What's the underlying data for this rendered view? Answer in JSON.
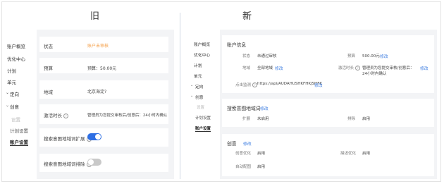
{
  "old": {
    "title": "旧",
    "nav": [
      {
        "label": "账户概览"
      },
      {
        "label": "优化中心"
      },
      {
        "label": "计划"
      },
      {
        "label": "单元"
      },
      {
        "label": "定向"
      },
      {
        "label": "创意"
      },
      {
        "label": "设置"
      },
      {
        "label": "计划设置"
      },
      {
        "label": "账户设置"
      }
    ],
    "rows": {
      "status_label": "状态",
      "status_value": "账户未审核",
      "budget_label": "预算",
      "budget_value": "预算：50.00元",
      "region_label": "地域",
      "region_value": "北京海淀?",
      "activation_label": "激活时长",
      "activation_value": "管理员为您提交审核后/创意后：24小时内确认",
      "expand_label": "搜索意图地域词扩展",
      "expand_toggle": "on",
      "exclude_label": "搜索意图地域词排除",
      "exclude_toggle": "off"
    }
  },
  "new": {
    "title": "新",
    "nav": [
      {
        "label": "账户概览"
      },
      {
        "label": "优化中心"
      },
      {
        "label": "计划"
      },
      {
        "label": "单元"
      },
      {
        "label": "定向"
      },
      {
        "label": "创意"
      },
      {
        "label": "设置"
      },
      {
        "label": "计划设置"
      },
      {
        "label": "账户设置"
      }
    ],
    "account": {
      "title": "账户信息",
      "status_label": "状态",
      "status_value": "未通过审核",
      "budget_label": "预算",
      "budget_value": "500.00元",
      "budget_edit": "修改",
      "region_label": "地域",
      "region_value": "全部地域",
      "region_edit": "修改",
      "activation_label": "激活时长",
      "activation_value_1": "管理员为您提交审核/创意后：",
      "activation_value_2": "24小时内确认",
      "activation_edit": "修改",
      "monitor_label": "点击监测",
      "monitor_value": "https://api/AUDAHUSHKFHKJSHFK",
      "monitor_edit": "修改"
    },
    "search": {
      "title": "搜索意图地域词",
      "title_edit": "修改",
      "expand_label": "扩展",
      "expand_value": "未启用",
      "exclude_label": "排除",
      "exclude_value": "启用"
    },
    "creative": {
      "title": "创意",
      "title_edit": "修改",
      "smart_label": "创意优化",
      "smart_value": "启用",
      "desc_label": "描述优化",
      "desc_value": "启用",
      "auto_label": "自动配图",
      "auto_value": "启用"
    }
  },
  "colors": {
    "accent": "#3a7be0",
    "toggle_on": "#2f6fe4",
    "toggle_off": "#c9c9c9",
    "warning": "#f5a04a",
    "error": "#e2424b"
  }
}
